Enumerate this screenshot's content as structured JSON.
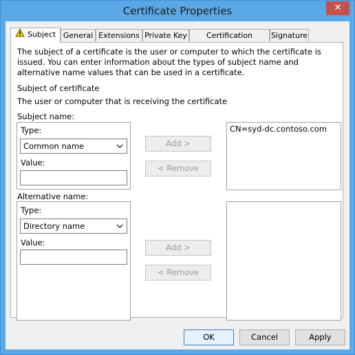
{
  "window": {
    "title": "Certificate Properties",
    "close_glyph": "✕"
  },
  "tabs": [
    {
      "label": "Subject",
      "active": true
    },
    {
      "label": "General"
    },
    {
      "label": "Extensions"
    },
    {
      "label": "Private Key"
    },
    {
      "label": "Certification Authority"
    },
    {
      "label": "Signature"
    }
  ],
  "subject_tab": {
    "description": "The subject of a certificate is the user or computer to which the certificate is issued. You can enter information about the types of subject name and alternative name values that can be used in a certificate.",
    "section_title": "Subject of certificate",
    "section_subtitle": "The user or computer that is receiving the certificate",
    "subject_name": {
      "label": "Subject name:",
      "type_label": "Type:",
      "type_value": "Common name",
      "value_label": "Value:",
      "value": "",
      "add_label": "Add >",
      "remove_label": "< Remove",
      "list": [
        "CN=syd-dc.contoso.com"
      ]
    },
    "alternative_name": {
      "label": "Alternative name:",
      "type_label": "Type:",
      "type_value": "Directory name",
      "value_label": "Value:",
      "value": "",
      "add_label": "Add >",
      "remove_label": "< Remove",
      "list": []
    }
  },
  "footer": {
    "ok_label": "OK",
    "cancel_label": "Cancel",
    "apply_label": "Apply"
  },
  "colors": {
    "titlebar": "#5aa9e6",
    "close": "#c7504a",
    "warning": "#f5d000"
  }
}
